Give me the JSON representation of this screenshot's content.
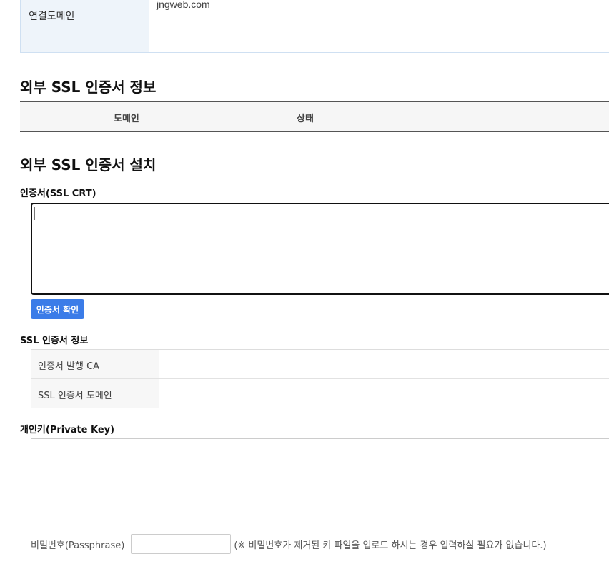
{
  "connected_domain": {
    "label": "연결도메인",
    "value": "jngweb.com"
  },
  "ssl_info": {
    "title": "외부 SSL 인증서 정보",
    "columns": [
      "도메인",
      "상태"
    ]
  },
  "ssl_install": {
    "title": "외부 SSL 인증서 설치",
    "crt_label": "인증서(SSL CRT)",
    "check_button": "인증서 확인",
    "cert_info_title": "SSL 인증서 정보",
    "cert_info_rows": [
      {
        "label": "인증서 발행 CA",
        "value": ""
      },
      {
        "label": "SSL 인증서 도메인",
        "value": ""
      }
    ],
    "private_key_label": "개인키(Private Key)",
    "passphrase_label": "비밀번호(Passphrase)",
    "passphrase_value": "",
    "passphrase_note": "(※ 비밀번호가 제거된 키 파일을 업로드 하시는 경우 입력하실 필요가 없습니다.)"
  },
  "colors": {
    "primary_button": "#3b7ce8",
    "domain_table_header": "#eef4fa"
  }
}
